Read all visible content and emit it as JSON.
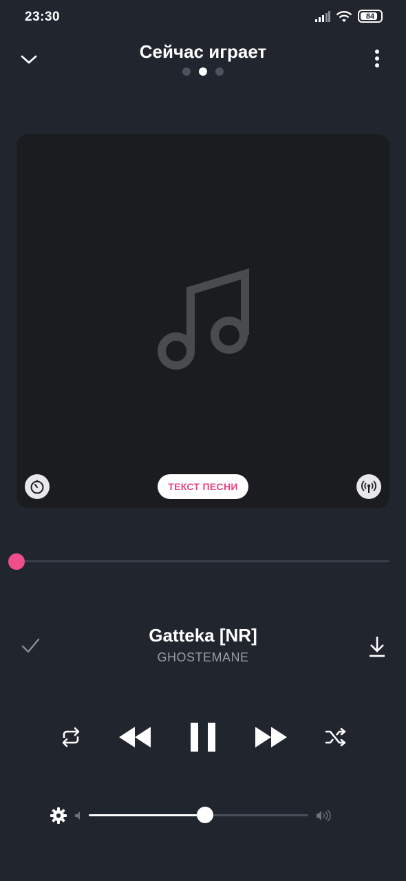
{
  "status_bar": {
    "time": "23:30",
    "battery_level": "84",
    "icons": [
      "signal-icon",
      "wifi-icon",
      "battery-icon"
    ]
  },
  "header": {
    "title": "Сейчас играет",
    "page_count": 3,
    "active_page": 2
  },
  "artwork": {
    "placeholder_icon": "music-note-icon",
    "lyrics_button_label": "ТЕКСТ ПЕСНИ",
    "left_button_icon": "timer-icon",
    "right_button_icon": "broadcast-icon"
  },
  "playback": {
    "progress_fraction": 0.0
  },
  "track": {
    "title": "Gatteka [NR]",
    "artist": "GHOSTEMANE"
  },
  "controls": {
    "icons": [
      "repeat-icon",
      "rewind-icon",
      "pause-icon",
      "fast-forward-icon",
      "shuffle-icon"
    ]
  },
  "volume": {
    "level_fraction": 0.53
  },
  "colors": {
    "background": "#21252d",
    "card": "#1a1c20",
    "accent": "#f04d8b",
    "lyrics_text": "#e9407f",
    "muted_text": "#9a9ea7"
  }
}
